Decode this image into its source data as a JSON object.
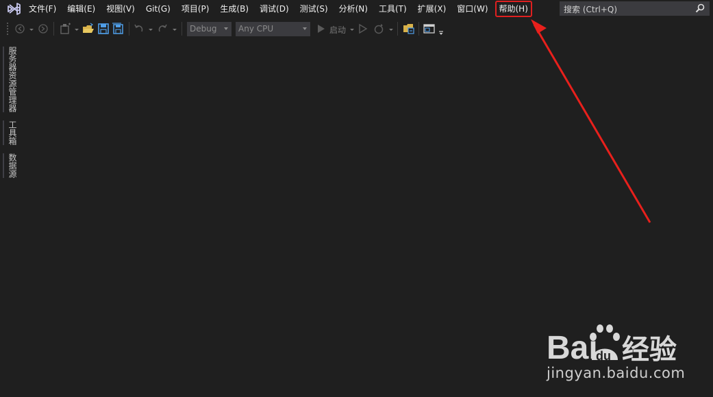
{
  "menu": {
    "items": [
      {
        "label": "文件(F)"
      },
      {
        "label": "编辑(E)"
      },
      {
        "label": "视图(V)"
      },
      {
        "label": "Git(G)"
      },
      {
        "label": "项目(P)"
      },
      {
        "label": "生成(B)"
      },
      {
        "label": "调试(D)"
      },
      {
        "label": "测试(S)"
      },
      {
        "label": "分析(N)"
      },
      {
        "label": "工具(T)"
      },
      {
        "label": "扩展(X)"
      },
      {
        "label": "窗口(W)"
      },
      {
        "label": "帮助(H)",
        "highlighted": true
      }
    ]
  },
  "search": {
    "placeholder": "搜索 (Ctrl+Q)",
    "icon": "search-icon"
  },
  "toolbar": {
    "configuration": "Debug",
    "platform": "Any CPU",
    "start_label": "启动"
  },
  "side_tabs": [
    {
      "label": "服务器资源管理器"
    },
    {
      "label": "工具箱"
    },
    {
      "label": "数据源"
    }
  ],
  "annotation": {
    "highlight_color": "#e02020",
    "arrow_color": "#e8201c"
  },
  "watermark": {
    "brand_latin": "Bai",
    "brand_du": "du",
    "brand_cn": "经验",
    "url": "jingyan.baidu.com"
  },
  "colors": {
    "background": "#1f1f1f",
    "accent_logo": "#7a6fd4",
    "search_bg": "#3b3b3f",
    "icon_yellow": "#d9b24a",
    "icon_blue": "#4f9ee8"
  }
}
